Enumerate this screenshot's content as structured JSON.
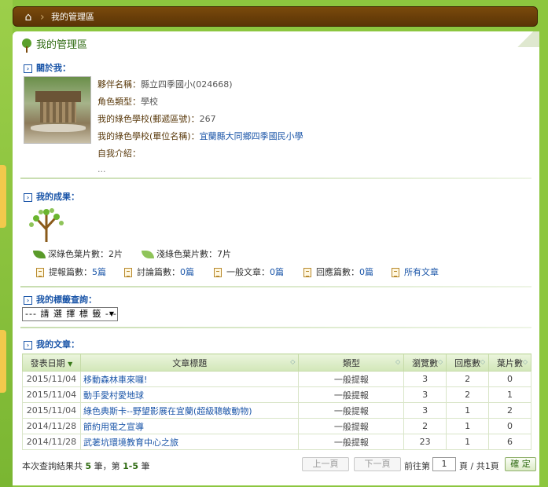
{
  "breadcrumb": {
    "home_icon": "home-icon",
    "current": "我的管理區"
  },
  "panel": {
    "title": "我的管理區"
  },
  "about": {
    "heading": "關於我：",
    "partner_label": "夥伴名稱：",
    "partner_value": "縣立四季國小(024668)",
    "role_label": "角色類型：",
    "role_value": "學校",
    "postal_label": "我的綠色學校(郵遞區號)：",
    "postal_value": "267",
    "unit_label": "我的綠色學校(單位名稱)：",
    "unit_value": "宜蘭縣大同鄉四季國民小學",
    "intro_label": "自我介紹：",
    "intro_value": "..."
  },
  "achievements": {
    "heading": "我的成果：",
    "dark_leaf_label": "深綠色葉片數：",
    "dark_leaf_value": "2片",
    "light_leaf_label": "淺綠色葉片數：",
    "light_leaf_value": "7片",
    "report_label": "提報篇數：",
    "report_value": "5篇",
    "discuss_label": "討論篇數：",
    "discuss_value": "0篇",
    "article_label": "一般文章：",
    "article_value": "0篇",
    "reply_label": "回應篇數：",
    "reply_value": "0篇",
    "all_link": "所有文章"
  },
  "tags": {
    "heading": "我的標籤查詢：",
    "select_value": "--- 請 選 擇 標 籤 ---"
  },
  "articles": {
    "heading": "我的文章：",
    "columns": [
      "發表日期",
      "文章標題",
      "類型",
      "瀏覽數",
      "回應數",
      "葉片數"
    ],
    "rows": [
      {
        "date": "2015/11/04",
        "title": "移動森林車來囉!",
        "type": "一般提報",
        "views": "3",
        "replies": "2",
        "leaves": "0"
      },
      {
        "date": "2015/11/04",
        "title": "動手愛村愛地球",
        "type": "一般提報",
        "views": "3",
        "replies": "2",
        "leaves": "1"
      },
      {
        "date": "2015/11/04",
        "title": "綠色典斯卡--野望影展在宜蘭(超級聰敏動物)",
        "type": "一般提報",
        "views": "3",
        "replies": "1",
        "leaves": "2"
      },
      {
        "date": "2014/11/28",
        "title": "節約用電之宣導",
        "type": "一般提報",
        "views": "2",
        "replies": "1",
        "leaves": "0"
      },
      {
        "date": "2014/11/28",
        "title": "武荖坑環境教育中心之旅",
        "type": "一般提報",
        "views": "23",
        "replies": "1",
        "leaves": "6"
      }
    ]
  },
  "pager": {
    "summary_prefix": "本次查詢結果共",
    "count": "5",
    "summary_mid": "筆，第",
    "range": "1-5",
    "summary_suffix": "筆",
    "prev": "上一頁",
    "next": "下一頁",
    "goto_label": "前往第",
    "page_value": "1",
    "total_label": "頁 / 共1頁",
    "confirm": "確 定"
  }
}
